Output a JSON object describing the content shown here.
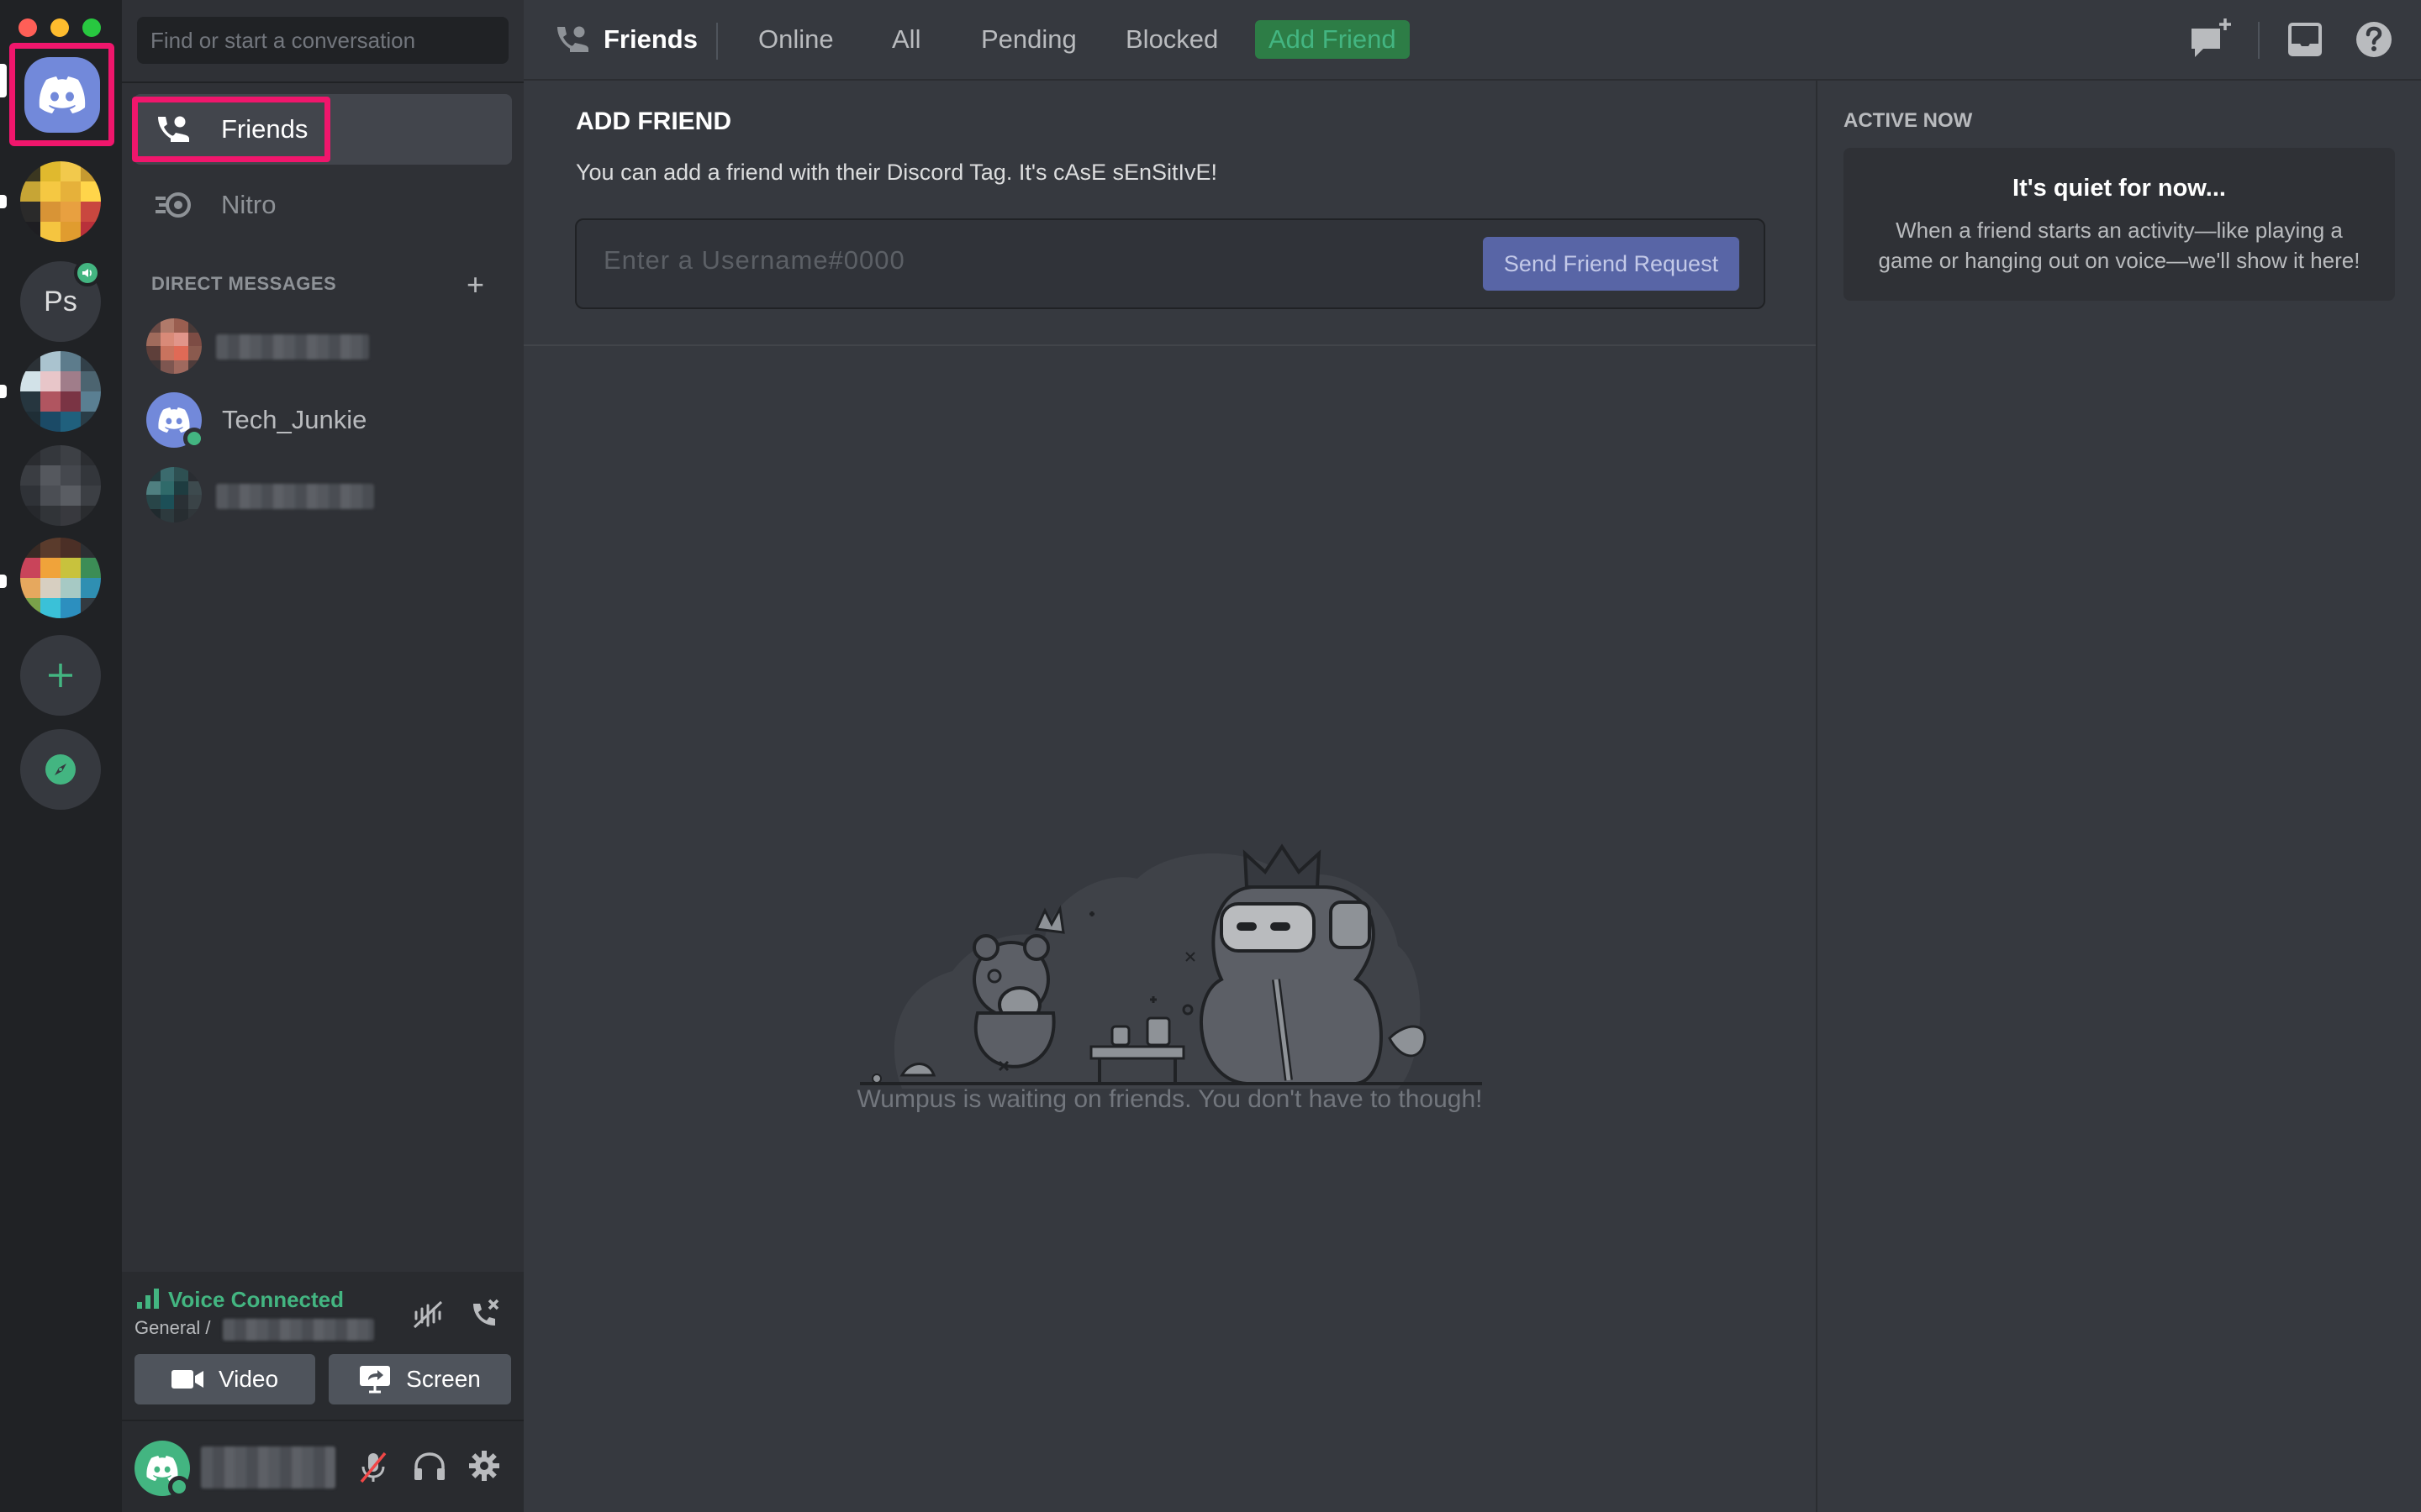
{
  "window": {
    "traffic_lights": [
      "close",
      "minimize",
      "zoom"
    ]
  },
  "colors": {
    "blurple": "#7289da",
    "green": "#43b581",
    "highlight": "#f0166c",
    "bg_main": "#36393f",
    "bg_sidebar": "#2f3136",
    "bg_rail": "#202225"
  },
  "servers": [
    {
      "label": "Ps",
      "has_voice_badge": true
    }
  ],
  "search": {
    "placeholder": "Find or start a conversation"
  },
  "nav": {
    "friends_label": "Friends",
    "nitro_label": "Nitro"
  },
  "direct_messages": {
    "header": "DIRECT MESSAGES",
    "add_icon": "plus-icon",
    "items": [
      {
        "name": "",
        "blurred": true
      },
      {
        "name": "Tech_Junkie",
        "status": "online"
      },
      {
        "name": "",
        "blurred": true
      }
    ]
  },
  "voice": {
    "status": "Voice Connected",
    "channel": "General /",
    "video_label": "Video",
    "screen_label": "Screen"
  },
  "header": {
    "title": "Friends",
    "tabs": [
      "Online",
      "All",
      "Pending",
      "Blocked"
    ],
    "add_friend": "Add Friend",
    "icons": [
      "new-group-dm-icon",
      "inbox-icon",
      "help-icon"
    ]
  },
  "add_friend": {
    "title": "ADD FRIEND",
    "description": "You can add a friend with their Discord Tag. It's cAsE sEnSitIvE!",
    "placeholder": "Enter a Username#0000",
    "button": "Send Friend Request"
  },
  "empty_state": {
    "text": "Wumpus is waiting on friends. You don't have to though!"
  },
  "active_now": {
    "title": "ACTIVE NOW",
    "card_title": "It's quiet for now...",
    "card_body": "When a friend starts an activity—like playing a game or hanging out on voice—we'll show it here!"
  }
}
